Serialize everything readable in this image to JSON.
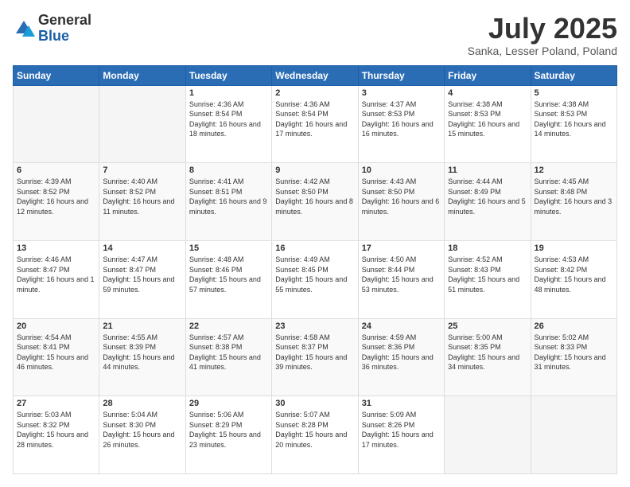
{
  "logo": {
    "general": "General",
    "blue": "Blue"
  },
  "title": "July 2025",
  "subtitle": "Sanka, Lesser Poland, Poland",
  "days_of_week": [
    "Sunday",
    "Monday",
    "Tuesday",
    "Wednesday",
    "Thursday",
    "Friday",
    "Saturday"
  ],
  "weeks": [
    [
      {
        "day": "",
        "info": ""
      },
      {
        "day": "",
        "info": ""
      },
      {
        "day": "1",
        "info": "Sunrise: 4:36 AM\nSunset: 8:54 PM\nDaylight: 16 hours and 18 minutes."
      },
      {
        "day": "2",
        "info": "Sunrise: 4:36 AM\nSunset: 8:54 PM\nDaylight: 16 hours and 17 minutes."
      },
      {
        "day": "3",
        "info": "Sunrise: 4:37 AM\nSunset: 8:53 PM\nDaylight: 16 hours and 16 minutes."
      },
      {
        "day": "4",
        "info": "Sunrise: 4:38 AM\nSunset: 8:53 PM\nDaylight: 16 hours and 15 minutes."
      },
      {
        "day": "5",
        "info": "Sunrise: 4:38 AM\nSunset: 8:53 PM\nDaylight: 16 hours and 14 minutes."
      }
    ],
    [
      {
        "day": "6",
        "info": "Sunrise: 4:39 AM\nSunset: 8:52 PM\nDaylight: 16 hours and 12 minutes."
      },
      {
        "day": "7",
        "info": "Sunrise: 4:40 AM\nSunset: 8:52 PM\nDaylight: 16 hours and 11 minutes."
      },
      {
        "day": "8",
        "info": "Sunrise: 4:41 AM\nSunset: 8:51 PM\nDaylight: 16 hours and 9 minutes."
      },
      {
        "day": "9",
        "info": "Sunrise: 4:42 AM\nSunset: 8:50 PM\nDaylight: 16 hours and 8 minutes."
      },
      {
        "day": "10",
        "info": "Sunrise: 4:43 AM\nSunset: 8:50 PM\nDaylight: 16 hours and 6 minutes."
      },
      {
        "day": "11",
        "info": "Sunrise: 4:44 AM\nSunset: 8:49 PM\nDaylight: 16 hours and 5 minutes."
      },
      {
        "day": "12",
        "info": "Sunrise: 4:45 AM\nSunset: 8:48 PM\nDaylight: 16 hours and 3 minutes."
      }
    ],
    [
      {
        "day": "13",
        "info": "Sunrise: 4:46 AM\nSunset: 8:47 PM\nDaylight: 16 hours and 1 minute."
      },
      {
        "day": "14",
        "info": "Sunrise: 4:47 AM\nSunset: 8:47 PM\nDaylight: 15 hours and 59 minutes."
      },
      {
        "day": "15",
        "info": "Sunrise: 4:48 AM\nSunset: 8:46 PM\nDaylight: 15 hours and 57 minutes."
      },
      {
        "day": "16",
        "info": "Sunrise: 4:49 AM\nSunset: 8:45 PM\nDaylight: 15 hours and 55 minutes."
      },
      {
        "day": "17",
        "info": "Sunrise: 4:50 AM\nSunset: 8:44 PM\nDaylight: 15 hours and 53 minutes."
      },
      {
        "day": "18",
        "info": "Sunrise: 4:52 AM\nSunset: 8:43 PM\nDaylight: 15 hours and 51 minutes."
      },
      {
        "day": "19",
        "info": "Sunrise: 4:53 AM\nSunset: 8:42 PM\nDaylight: 15 hours and 48 minutes."
      }
    ],
    [
      {
        "day": "20",
        "info": "Sunrise: 4:54 AM\nSunset: 8:41 PM\nDaylight: 15 hours and 46 minutes."
      },
      {
        "day": "21",
        "info": "Sunrise: 4:55 AM\nSunset: 8:39 PM\nDaylight: 15 hours and 44 minutes."
      },
      {
        "day": "22",
        "info": "Sunrise: 4:57 AM\nSunset: 8:38 PM\nDaylight: 15 hours and 41 minutes."
      },
      {
        "day": "23",
        "info": "Sunrise: 4:58 AM\nSunset: 8:37 PM\nDaylight: 15 hours and 39 minutes."
      },
      {
        "day": "24",
        "info": "Sunrise: 4:59 AM\nSunset: 8:36 PM\nDaylight: 15 hours and 36 minutes."
      },
      {
        "day": "25",
        "info": "Sunrise: 5:00 AM\nSunset: 8:35 PM\nDaylight: 15 hours and 34 minutes."
      },
      {
        "day": "26",
        "info": "Sunrise: 5:02 AM\nSunset: 8:33 PM\nDaylight: 15 hours and 31 minutes."
      }
    ],
    [
      {
        "day": "27",
        "info": "Sunrise: 5:03 AM\nSunset: 8:32 PM\nDaylight: 15 hours and 28 minutes."
      },
      {
        "day": "28",
        "info": "Sunrise: 5:04 AM\nSunset: 8:30 PM\nDaylight: 15 hours and 26 minutes."
      },
      {
        "day": "29",
        "info": "Sunrise: 5:06 AM\nSunset: 8:29 PM\nDaylight: 15 hours and 23 minutes."
      },
      {
        "day": "30",
        "info": "Sunrise: 5:07 AM\nSunset: 8:28 PM\nDaylight: 15 hours and 20 minutes."
      },
      {
        "day": "31",
        "info": "Sunrise: 5:09 AM\nSunset: 8:26 PM\nDaylight: 15 hours and 17 minutes."
      },
      {
        "day": "",
        "info": ""
      },
      {
        "day": "",
        "info": ""
      }
    ]
  ]
}
